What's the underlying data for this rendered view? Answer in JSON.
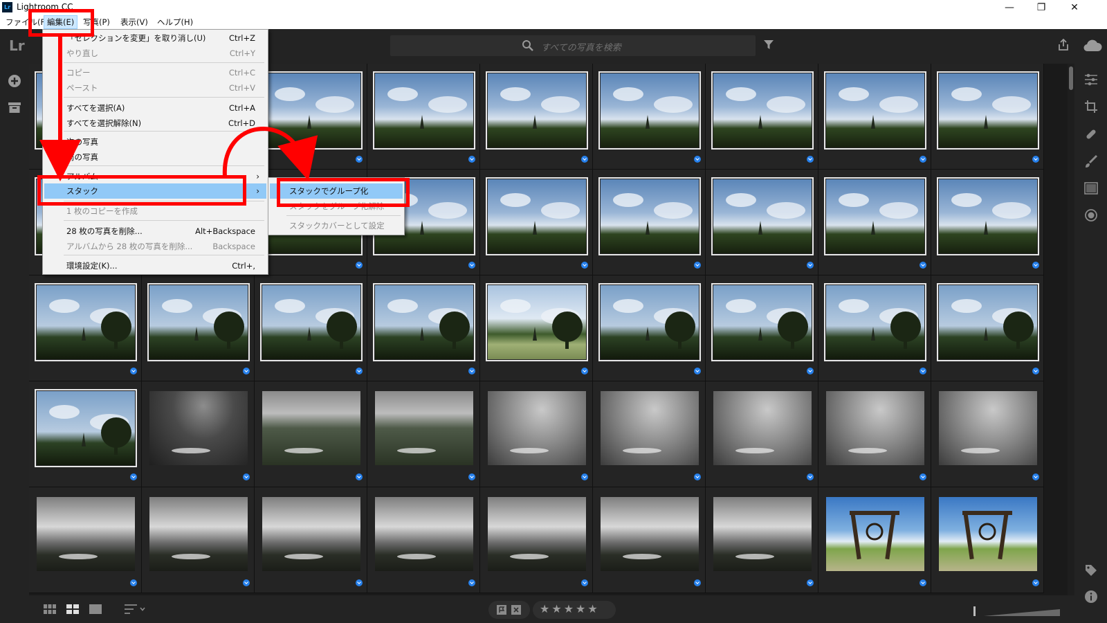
{
  "window": {
    "title": "Lightroom CC",
    "minimize": "—",
    "maximize": "❐",
    "close": "✕"
  },
  "menubar": {
    "items": [
      "ファイル(F)",
      "編集(E)",
      "写真(P)",
      "表示(V)",
      "ヘルプ(H)"
    ],
    "active_index": 1
  },
  "toolbar": {
    "logo": "Lr",
    "search_placeholder": "すべての写真を検索"
  },
  "edit_menu": {
    "items": [
      {
        "label": "「セレクションを変更」を取り消し(U)",
        "shortcut": "Ctrl+Z",
        "disabled": false
      },
      {
        "label": "やり直し",
        "shortcut": "Ctrl+Y",
        "disabled": true
      },
      {
        "label": "コピー",
        "shortcut": "Ctrl+C",
        "disabled": true
      },
      {
        "label": "ペースト",
        "shortcut": "Ctrl+V",
        "disabled": true
      },
      {
        "label": "すべてを選択(A)",
        "shortcut": "Ctrl+A",
        "disabled": false
      },
      {
        "label": "すべてを選択解除(N)",
        "shortcut": "Ctrl+D",
        "disabled": false
      },
      {
        "label": "次の写真",
        "shortcut": "",
        "disabled": false
      },
      {
        "label": "前の写真",
        "shortcut": "",
        "disabled": false
      },
      {
        "label": "アルバム",
        "shortcut": "",
        "disabled": false,
        "submenu": true
      },
      {
        "label": "スタック",
        "shortcut": "",
        "disabled": false,
        "submenu": true,
        "highlighted": true
      },
      {
        "label": "1 枚のコピーを作成",
        "shortcut": "",
        "disabled": true
      },
      {
        "label": "28 枚の写真を削除...",
        "shortcut": "Alt+Backspace",
        "disabled": false
      },
      {
        "label": "アルバムから 28 枚の写真を削除...",
        "shortcut": "Backspace",
        "disabled": true
      },
      {
        "label": "環境設定(K)...",
        "shortcut": "Ctrl+,",
        "disabled": false
      }
    ]
  },
  "stack_submenu": {
    "items": [
      {
        "label": "スタックでグループ化",
        "disabled": false,
        "highlighted": true
      },
      {
        "label": "スタックをグループ化解除",
        "disabled": true
      },
      {
        "label": "スタックカバーとして設定",
        "disabled": true
      }
    ]
  },
  "grid": {
    "columns": 9,
    "rows": [
      [
        "sky",
        "sky",
        "sky",
        "sky",
        "sky",
        "sky",
        "sky",
        "sky",
        "sky"
      ],
      [
        "sky",
        "sky",
        "sky",
        "sky",
        "sky",
        "sky",
        "sky",
        "sky",
        "sky"
      ],
      [
        "sky-tree",
        "sky-tree",
        "sky-tree",
        "sky-tree",
        "sky-bright",
        "sky-tree",
        "sky-tree",
        "sky-tree",
        "sky-tree"
      ],
      [
        "sky-tree",
        "fog-dark",
        "fog-lake",
        "fog-lake",
        "fog-grey",
        "fog-grey",
        "fog-grey",
        "fog-grey",
        "fog-grey"
      ],
      [
        "cloud-lake",
        "cloud-lake",
        "cloud-lake",
        "cloud-lake",
        "cloud-lake",
        "cloud-lake",
        "cloud-lake",
        "frame-sky",
        "frame-sky"
      ]
    ],
    "selected_rows": [
      0,
      1,
      2
    ],
    "selected_extra": [
      [
        3,
        0
      ]
    ]
  },
  "bottombar": {
    "stars": "★★★★★"
  },
  "colors": {
    "annotation_red": "#ff0000",
    "selection_blue": "#2680eb",
    "menu_highlight": "#91c9f7"
  }
}
